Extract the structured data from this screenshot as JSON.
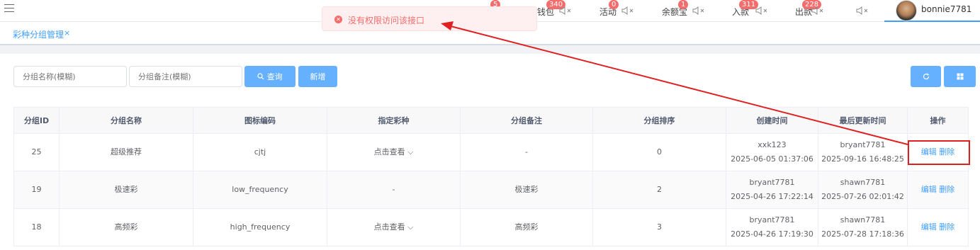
{
  "header": {
    "items": [
      {
        "label": "钱包",
        "badge": "340"
      },
      {
        "label": "活动",
        "badge": "0"
      },
      {
        "label": "余额宝",
        "badge": "1"
      },
      {
        "label": "入款",
        "badge": "311"
      },
      {
        "label": "出款",
        "badge": "228"
      }
    ],
    "first_badge": "5",
    "username": "bonnie7781"
  },
  "tabs": {
    "active": "彩种分组管理",
    "close": "×"
  },
  "toast": {
    "message": "没有权限访问该接口",
    "type": "error"
  },
  "search": {
    "name_placeholder": "分组名称(模糊)",
    "remark_placeholder": "分组备注(模糊)",
    "query_label": "查询",
    "add_label": "新增"
  },
  "table": {
    "columns": [
      "分组ID",
      "分组名称",
      "图标编码",
      "指定彩种",
      "分组备注",
      "分组排序",
      "创建时间",
      "最后更新时间",
      "操作"
    ],
    "rows": [
      {
        "id": "25",
        "name": "超级推荐",
        "icon": "cjtj",
        "lottery": "点击查看",
        "remark": "-",
        "sort": "0",
        "creator": "xxk123",
        "created": "2025-06-05 01:37:06",
        "updater": "bryant7781",
        "updated": "2025-09-16 16:48:25"
      },
      {
        "id": "19",
        "name": "极速彩",
        "icon": "low_frequency",
        "lottery": "-",
        "remark": "极速彩",
        "sort": "2",
        "creator": "bryant7781",
        "created": "2025-04-26 17:22:14",
        "updater": "shawn7781",
        "updated": "2025-07-26 02:01:42"
      },
      {
        "id": "18",
        "name": "高频彩",
        "icon": "high_frequency",
        "lottery": "点击查看",
        "remark": "高频彩",
        "sort": "3",
        "creator": "bryant7781",
        "created": "2025-04-26 17:19:30",
        "updater": "shawn7781",
        "updated": "2025-07-28 17:18:36"
      }
    ],
    "edit_label": "编辑",
    "delete_label": "删除"
  },
  "colors": {
    "primary": "#409eff",
    "danger": "#f56c6c",
    "annotation": "#e02020"
  }
}
